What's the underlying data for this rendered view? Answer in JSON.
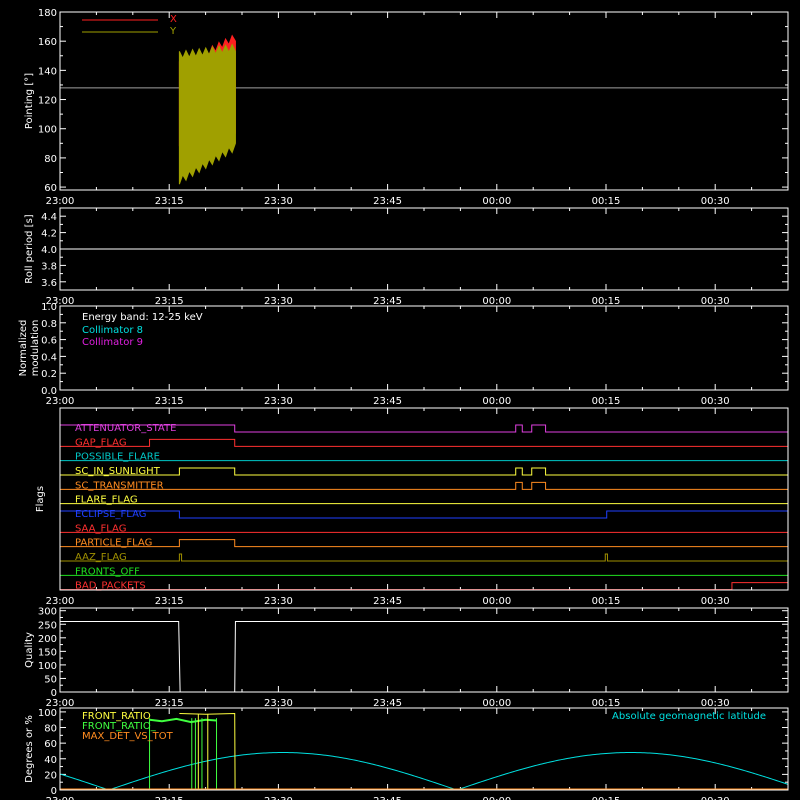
{
  "time_axis": {
    "tick_labels": [
      "23:00",
      "23:15",
      "23:30",
      "23:45",
      "00:00",
      "00:15",
      "00:30"
    ],
    "tick_minutes": [
      0,
      15,
      30,
      45,
      60,
      75,
      90
    ],
    "range_minutes": [
      0,
      100
    ]
  },
  "chart_data": [
    {
      "type": "line",
      "ylabel": "Pointing [°]",
      "ylim": [
        58,
        180
      ],
      "yticks": [
        60,
        80,
        100,
        120,
        140,
        160,
        180
      ],
      "legend": {
        "placement": "top-left",
        "entries": [
          {
            "name": "X",
            "color": "#ff2020"
          },
          {
            "name": "Y",
            "color": "#a0a000"
          }
        ]
      },
      "series": [
        {
          "name": "X",
          "color": "#ff2020",
          "envelope": {
            "x_start": 16.4,
            "x_end": 24.1,
            "upper_start": 145,
            "upper_end": 165,
            "lower_start": 88,
            "lower_end": 92,
            "period": 0.9
          }
        },
        {
          "name": "Y",
          "color": "#a0a000",
          "envelope": {
            "x_start": 16.4,
            "x_end": 24.1,
            "upper_start": 153,
            "upper_end": 158,
            "lower_start": 62,
            "lower_end": 85,
            "period": 0.9
          }
        },
        {
          "name": "reference",
          "color": "#a0a0a0",
          "constant": 128
        }
      ]
    },
    {
      "type": "line",
      "ylabel": "Roll period [s]",
      "ylim": [
        3.5,
        4.5
      ],
      "yticks": [
        3.6,
        3.8,
        4.0,
        4.2,
        4.4
      ],
      "tick_labels": [
        "3.6",
        "3.8",
        "4.0",
        "4.2",
        "4.4"
      ],
      "series": [
        {
          "name": "roll",
          "color": "#ffffff",
          "constant": 4.0
        }
      ]
    },
    {
      "type": "line",
      "ylabel": "Normalized modulation",
      "ylim": [
        0,
        1.0
      ],
      "yticks": [
        0,
        0.2,
        0.4,
        0.6,
        0.8,
        1.0
      ],
      "tick_labels": [
        "0.0",
        "0.2",
        "0.4",
        "0.6",
        "0.8",
        "1.0"
      ],
      "legend": {
        "title": "Energy band: 12-25 keV",
        "entries": [
          {
            "name": "Collimator 8",
            "color": "#00e0e0"
          },
          {
            "name": "Collimator 9",
            "color": "#e020e0"
          }
        ]
      },
      "series": [
        {
          "name": "Collimator 9",
          "color": "#e020e0",
          "constant": 0
        }
      ]
    },
    {
      "type": "line",
      "ylabel": "Flags",
      "flags": [
        {
          "name": "ATTENUATOR_STATE",
          "color": "#e040e0",
          "on": [
            [
              0,
              24.0
            ],
            [
              62.6,
              63.5
            ],
            [
              64.8,
              66.7
            ]
          ]
        },
        {
          "name": "GAP_FLAG",
          "color": "#ff3030",
          "on": [
            [
              12.3,
              24.0
            ]
          ]
        },
        {
          "name": "POSSIBLE_FLARE",
          "color": "#00c8c8",
          "on": []
        },
        {
          "name": "SC_IN_SUNLIGHT",
          "color": "#ffff40",
          "on": [
            [
              16.4,
              24.0
            ],
            [
              62.6,
              63.5
            ],
            [
              64.8,
              66.7
            ]
          ]
        },
        {
          "name": "SC_TRANSMITTER",
          "color": "#ff8c20",
          "on": [
            [
              62.6,
              63.5
            ],
            [
              64.8,
              66.7
            ]
          ]
        },
        {
          "name": "FLARE_FLAG",
          "color": "#ffff40",
          "on": []
        },
        {
          "name": "ECLIPSE_FLAG",
          "color": "#2040ff",
          "on": [
            [
              0,
              16.4
            ],
            [
              75.1,
              100
            ]
          ]
        },
        {
          "name": "SAA_FLAG",
          "color": "#ff3030",
          "on": []
        },
        {
          "name": "PARTICLE_FLAG",
          "color": "#ff8c20",
          "on": [
            [
              16.4,
              24.0
            ]
          ]
        },
        {
          "name": "AAZ_FLAG",
          "color": "#a09000",
          "on": [
            [
              16.4,
              16.7
            ],
            [
              74.9,
              75.2
            ]
          ]
        },
        {
          "name": "FRONTS_OFF",
          "color": "#20e020",
          "on": []
        },
        {
          "name": "BAD_PACKETS",
          "color": "#ff3030",
          "on": [
            [
              92.3,
              100
            ]
          ]
        }
      ]
    },
    {
      "type": "line",
      "ylabel": "Quality",
      "ylim": [
        0,
        310
      ],
      "yticks": [
        0,
        50,
        100,
        150,
        200,
        250,
        300
      ],
      "series": [
        {
          "name": "quality",
          "color": "#ffffff",
          "points": [
            [
              0,
              260
            ],
            [
              16.3,
              260
            ],
            [
              16.5,
              0
            ],
            [
              24.0,
              0
            ],
            [
              24.1,
              260
            ],
            [
              100,
              260
            ]
          ]
        }
      ]
    },
    {
      "type": "line",
      "ylabel": "Degrees or %",
      "ylim": [
        0,
        105
      ],
      "yticks": [
        0,
        20,
        40,
        60,
        80,
        100
      ],
      "legend": {
        "entries": [
          {
            "name": "FRONT_RATIO",
            "color": "#ffff40"
          },
          {
            "name": "FRONT_RATIO_",
            "color": "#40ff40"
          },
          {
            "name": "MAX_DET_VS_TOT",
            "color": "#ff8c20"
          }
        ]
      },
      "annotation": {
        "text": "Absolute geomagnetic latitude",
        "color": "#00e0e0"
      },
      "series": [
        {
          "name": "Absolute geomagnetic latitude",
          "color": "#00e0e0",
          "abs_sine": {
            "amplitude": 48,
            "zero_at": 6.7,
            "half_period": 47.8
          }
        },
        {
          "name": "FRONT_RATIO",
          "color": "#ffff40",
          "points": [
            [
              16.4,
              98
            ],
            [
              20,
              97
            ],
            [
              24.0,
              98
            ],
            [
              24.05,
              0
            ]
          ]
        },
        {
          "name": "FRONT_RATIO_",
          "color": "#40ff40",
          "points": [
            [
              12.3,
              90
            ],
            [
              14,
              88
            ],
            [
              16,
              91
            ],
            [
              18,
              87
            ],
            [
              20,
              90
            ],
            [
              21.5,
              89
            ]
          ]
        },
        {
          "name": "MAX_DET_VS_TOT",
          "color": "#ff8c20",
          "constant": 0
        }
      ]
    }
  ]
}
